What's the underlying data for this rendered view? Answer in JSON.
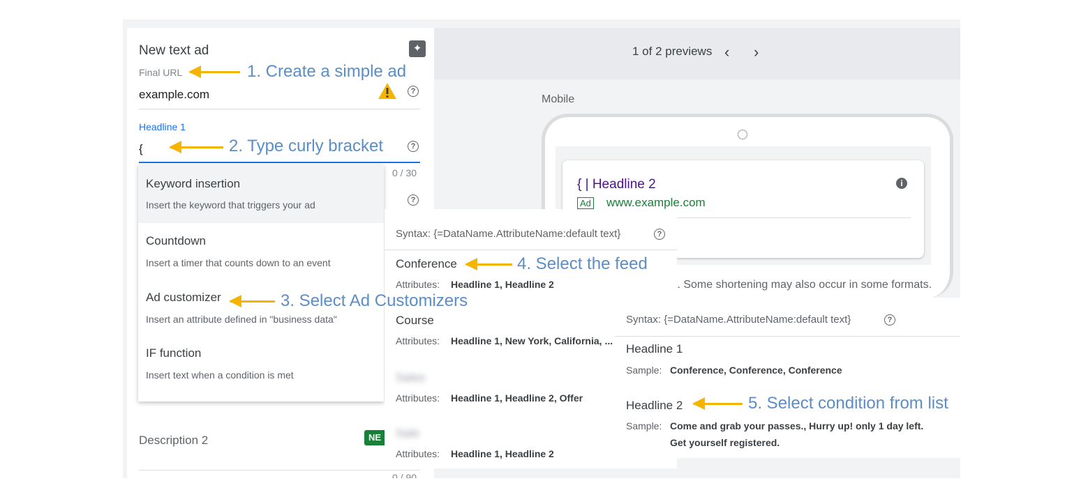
{
  "editor": {
    "title": "New text ad",
    "final_url_label": "Final URL",
    "final_url_value": "example.com",
    "headline1_label": "Headline 1",
    "headline1_value": "{",
    "headline1_count": "0 / 30",
    "description2_label": "Description 2",
    "new_badge": "NE",
    "description2_count": "0 / 90"
  },
  "preview": {
    "counter": "1 of 2 previews",
    "device": "Mobile",
    "ad_headline": "{ | Headline 2",
    "ad_badge": "Ad",
    "ad_url": "www.example.com",
    "note": "xt. Some shortening may also occur in some formats."
  },
  "menu": {
    "items": [
      {
        "title": "Keyword insertion",
        "sub": "Insert the keyword that triggers your ad"
      },
      {
        "title": "Countdown",
        "sub": "Insert a timer that counts down to an event"
      },
      {
        "title": "Ad customizer",
        "sub": "Insert an attribute defined in \"business data\""
      },
      {
        "title": "IF function",
        "sub": "Insert text when a condition is met"
      }
    ]
  },
  "feed": {
    "syntax": "Syntax: {=DataName.AttributeName:default text}",
    "attrs_label": "Attributes:",
    "items": [
      {
        "name": "Conference",
        "attrs": "Headline 1, Headline 2"
      },
      {
        "name": "Course",
        "attrs": "Headline 1, New York, California, ..."
      },
      {
        "name": "Sales",
        "attrs": "Headline 1, Headline 2, Offer"
      },
      {
        "name": "Sale",
        "attrs": "Headline 1, Headline 2"
      }
    ]
  },
  "attributes": {
    "syntax": "Syntax: {=DataName.AttributeName:default text}",
    "sample_label": "Sample:",
    "items": [
      {
        "name": "Headline 1",
        "sample": "Conference, Conference, Conference",
        "sample2": ""
      },
      {
        "name": "Headline 2",
        "sample": "Come and grab your passes., Hurry up! only 1 day left.",
        "sample2": "Get yourself registered."
      }
    ]
  },
  "annotations": {
    "step1": "1. Create a simple ad",
    "step2": "2. Type curly bracket",
    "step3": "3. Select Ad Customizers",
    "step4": "4. Select the feed",
    "step5": "5. Select condition from list"
  },
  "colors": {
    "annotation_text": "#5b8ec7",
    "arrow": "#f4b400",
    "link_blue": "#1a73e8",
    "ad_headline": "#4a148c",
    "ad_green": "#188038"
  }
}
